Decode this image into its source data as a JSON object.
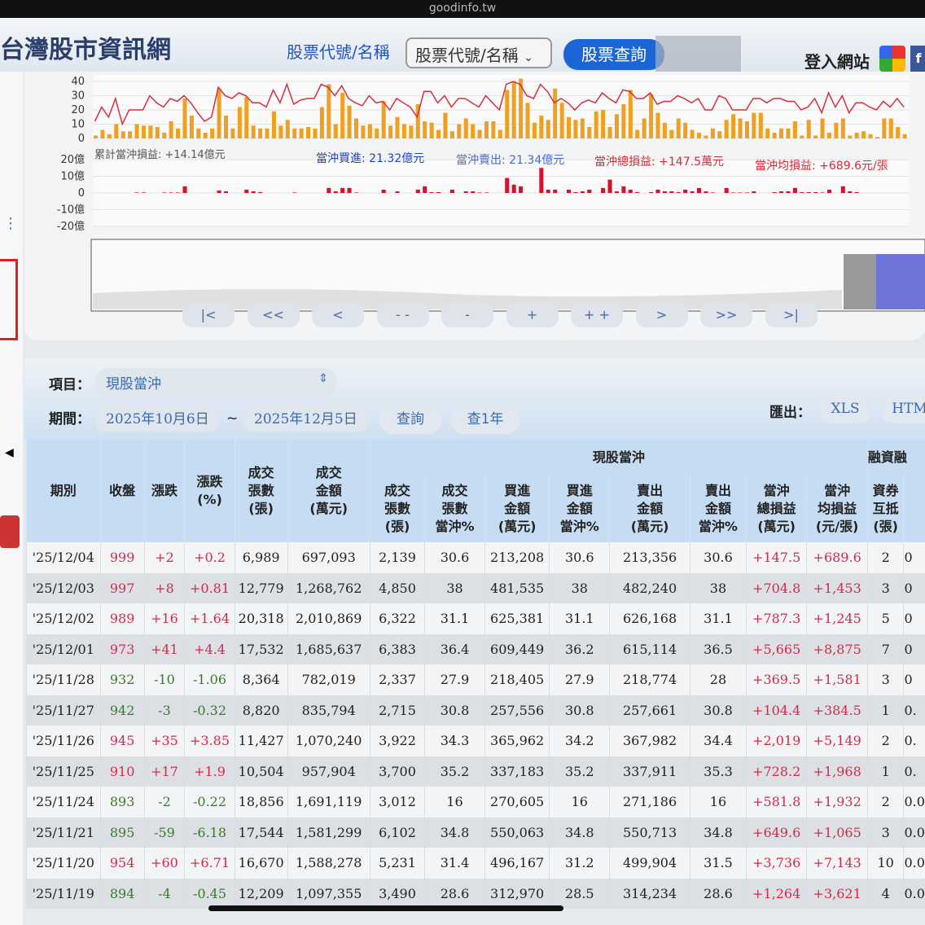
{
  "browser": {
    "url": "goodinfo.tw"
  },
  "header": {
    "site_title": "台灣股市資訊網",
    "search_label": "股票代號/名稱",
    "search_select": "股票代號/名稱",
    "query_button": "股票查詢",
    "login": "登入網站"
  },
  "chart_data": {
    "type": "bar",
    "volume_axis": {
      "ticks": [
        "40",
        "30",
        "20",
        "10",
        "0"
      ],
      "ylim": [
        0,
        40
      ]
    },
    "pnl_axis": {
      "ticks": [
        "20億",
        "10億",
        "0",
        "-10億",
        "-20億"
      ],
      "ylim": [
        -20,
        20
      ]
    },
    "summary": {
      "cumulative": "累計當沖損益: +14.14億元",
      "buy": "當沖買進: 21.32億元",
      "sell": "當沖賣出: 21.34億元",
      "total": "當沖總損益: +147.5萬元",
      "avg": "當沖均損益: +689.6元/張"
    },
    "volume": [
      2,
      6,
      3,
      10,
      5,
      5,
      10,
      9,
      9,
      8,
      4,
      12,
      7,
      28,
      16,
      7,
      4,
      7,
      35,
      16,
      7,
      22,
      29,
      9,
      7,
      7,
      19,
      9,
      13,
      7,
      7,
      8,
      7,
      22,
      38,
      10,
      32,
      23,
      14,
      9,
      10,
      7,
      26,
      9,
      15,
      10,
      9,
      24,
      12,
      11,
      6,
      18,
      5,
      10,
      14,
      10,
      6,
      12,
      12,
      6,
      34,
      40,
      42,
      25,
      11,
      16,
      13,
      35,
      25,
      15,
      13,
      14,
      8,
      19,
      20,
      8,
      17,
      24,
      34,
      6,
      14,
      31,
      18,
      11,
      6,
      14,
      11,
      6,
      4,
      2,
      7,
      5,
      13,
      17,
      14,
      12,
      18,
      18,
      7,
      4,
      7,
      7,
      12,
      2,
      13,
      2,
      14,
      4,
      11,
      14,
      2,
      4,
      5,
      3,
      1,
      14,
      14,
      8,
      3
    ],
    "daytrade_pct": [
      12,
      22,
      15,
      28,
      10,
      20,
      20,
      20,
      30,
      25,
      22,
      28,
      26,
      30,
      25,
      18,
      12,
      15,
      36,
      30,
      28,
      32,
      30,
      25,
      25,
      22,
      34,
      25,
      38,
      24,
      27,
      28,
      28,
      38,
      36,
      30,
      37,
      28,
      25,
      23,
      30,
      25,
      26,
      20,
      28,
      25,
      22,
      15,
      33,
      33,
      25,
      30,
      22,
      28,
      28,
      25,
      22,
      30,
      25,
      20,
      38,
      40,
      38,
      30,
      28,
      38,
      33,
      25,
      28,
      25,
      20,
      25,
      27,
      25,
      32,
      28,
      25,
      34,
      33,
      28,
      28,
      32,
      24,
      26,
      26,
      30,
      28,
      25,
      28,
      20,
      20,
      30,
      28,
      20,
      20,
      20,
      28,
      28,
      25,
      28,
      28,
      26,
      26,
      20,
      22,
      28,
      18,
      32,
      22,
      30,
      18,
      25,
      25,
      22,
      20,
      26,
      22,
      28,
      22
    ],
    "pnl": [
      0,
      0,
      0,
      0,
      0,
      0,
      0.3,
      0.3,
      0,
      0,
      0.3,
      0.3,
      0.3,
      4,
      0,
      0,
      0,
      0,
      1.5,
      1,
      0,
      0,
      2,
      1,
      0.5,
      0,
      0,
      0,
      0,
      0.3,
      0,
      0,
      0,
      0,
      3,
      1,
      3,
      3,
      0.3,
      0,
      0,
      0,
      2,
      0,
      1,
      0,
      0,
      2,
      4,
      0.5,
      0.5,
      0,
      2,
      0,
      1,
      1,
      0.3,
      0.3,
      0,
      0,
      9,
      5,
      4,
      0,
      0,
      15,
      2,
      2,
      0,
      2,
      0.5,
      1,
      2,
      0,
      3,
      8,
      1,
      4,
      2,
      0.5,
      0,
      0.5,
      2,
      1,
      1,
      0.5,
      2,
      1,
      3,
      1,
      0.3,
      0,
      3,
      0.3,
      0.3,
      0.3,
      1,
      0,
      0,
      0.5,
      1,
      1,
      3,
      0.5,
      0.5,
      0.5,
      0.3,
      2,
      0,
      4,
      1,
      0.5
    ]
  },
  "navigator": {
    "buttons": [
      "|<",
      "<<",
      "<",
      "- -",
      "-",
      "+",
      "+ +",
      ">",
      ">>",
      ">|"
    ]
  },
  "controls": {
    "item_label": "項目：",
    "item_value": "現股當沖",
    "period_label": "期間：",
    "start_date": "2025年10月6日",
    "tilde": "~",
    "end_date": "2025年12月5日",
    "query": "查詢",
    "query_year": "查1年",
    "export_label": "匯出：",
    "xls": "XLS",
    "html": "HTM"
  },
  "table": {
    "group_daytrade": "現股當沖",
    "group_margin": "融資融",
    "headers": [
      "期別",
      "收盤",
      "漲跌",
      "漲跌\n(%)",
      "成交\n張數\n(張)",
      "成交\n金額\n(萬元)",
      "成交\n張數\n(張)",
      "成交\n張數\n當沖%",
      "買進\n金額\n(萬元)",
      "買進\n金額\n當沖%",
      "賣出\n金額\n(萬元)",
      "賣出\n金額\n當沖%",
      "當沖\n總損益\n(萬元)",
      "當沖\n均損益\n(元/張)",
      "資券\n互抵\n(張)",
      ""
    ],
    "rows": [
      [
        "'25/12/04",
        "999",
        "+2",
        "+0.2",
        "6,989",
        "697,093",
        "2,139",
        "30.6",
        "213,208",
        "30.6",
        "213,356",
        "30.6",
        "+147.5",
        "+689.6",
        "2",
        "0"
      ],
      [
        "'25/12/03",
        "997",
        "+8",
        "+0.81",
        "12,779",
        "1,268,762",
        "4,850",
        "38",
        "481,535",
        "38",
        "482,240",
        "38",
        "+704.8",
        "+1,453",
        "3",
        "0"
      ],
      [
        "'25/12/02",
        "989",
        "+16",
        "+1.64",
        "20,318",
        "2,010,869",
        "6,322",
        "31.1",
        "625,381",
        "31.1",
        "626,168",
        "31.1",
        "+787.3",
        "+1,245",
        "5",
        "0"
      ],
      [
        "'25/12/01",
        "973",
        "+41",
        "+4.4",
        "17,532",
        "1,685,637",
        "6,383",
        "36.4",
        "609,449",
        "36.2",
        "615,114",
        "36.5",
        "+5,665",
        "+8,875",
        "7",
        "0"
      ],
      [
        "'25/11/28",
        "932",
        "-10",
        "-1.06",
        "8,364",
        "782,019",
        "2,337",
        "27.9",
        "218,405",
        "27.9",
        "218,774",
        "28",
        "+369.5",
        "+1,581",
        "3",
        "0"
      ],
      [
        "'25/11/27",
        "942",
        "-3",
        "-0.32",
        "8,820",
        "835,794",
        "2,715",
        "30.8",
        "257,556",
        "30.8",
        "257,661",
        "30.8",
        "+104.4",
        "+384.5",
        "1",
        "0."
      ],
      [
        "'25/11/26",
        "945",
        "+35",
        "+3.85",
        "11,427",
        "1,070,240",
        "3,922",
        "34.3",
        "365,962",
        "34.2",
        "367,982",
        "34.4",
        "+2,019",
        "+5,149",
        "2",
        "0."
      ],
      [
        "'25/11/25",
        "910",
        "+17",
        "+1.9",
        "10,504",
        "957,904",
        "3,700",
        "35.2",
        "337,183",
        "35.2",
        "337,911",
        "35.3",
        "+728.2",
        "+1,968",
        "1",
        "0."
      ],
      [
        "'25/11/24",
        "893",
        "-2",
        "-0.22",
        "18,856",
        "1,691,119",
        "3,012",
        "16",
        "270,605",
        "16",
        "271,186",
        "16",
        "+581.8",
        "+1,932",
        "2",
        "0.0"
      ],
      [
        "'25/11/21",
        "895",
        "-59",
        "-6.18",
        "17,544",
        "1,581,299",
        "6,102",
        "34.8",
        "550,063",
        "34.8",
        "550,713",
        "34.8",
        "+649.6",
        "+1,065",
        "3",
        "0.0"
      ],
      [
        "'25/11/20",
        "954",
        "+60",
        "+6.71",
        "16,670",
        "1,588,278",
        "5,231",
        "31.4",
        "496,167",
        "31.2",
        "499,904",
        "31.5",
        "+3,736",
        "+7,143",
        "10",
        "0.0"
      ],
      [
        "'25/11/19",
        "894",
        "-4",
        "-0.45",
        "12,209",
        "1,097,355",
        "3,490",
        "28.6",
        "312,970",
        "28.5",
        "314,234",
        "28.6",
        "+1,264",
        "+3,621",
        "4",
        "0.0"
      ]
    ]
  },
  "colors": {
    "up": "#d42a4a",
    "down": "#3a7a2a",
    "bar": "#f0a020",
    "line": "#d43040",
    "pnl": "#d8102a"
  }
}
